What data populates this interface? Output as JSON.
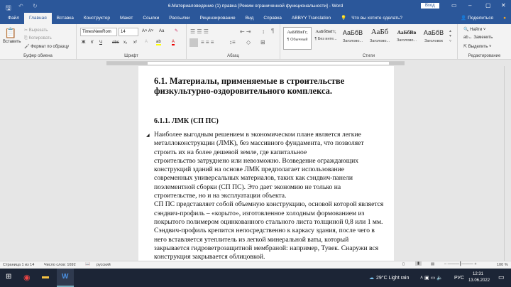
{
  "titlebar": {
    "title": "6.Материаловедение (1) правка [Режим ограниченной функциональности] - Word",
    "signin": "Вход"
  },
  "tabs": [
    "Файл",
    "Главная",
    "Вставка",
    "Конструктор",
    "Макет",
    "Ссылки",
    "Рассылки",
    "Рецензирование",
    "Вид",
    "Справка",
    "ABBYY Translation"
  ],
  "tell_me": "Что вы хотите сделать?",
  "share": "Поделиться",
  "clipboard": {
    "paste": "Вставить",
    "cut": "Вырезать",
    "copy": "Копировать",
    "format_painter": "Формат по образцу",
    "label": "Буфер обмена"
  },
  "font": {
    "name": "TimesNewRom",
    "size": "14",
    "label": "Шрифт",
    "bold": "Ж",
    "italic": "К",
    "underline": "Ч",
    "strike": "abc",
    "sub": "x₂",
    "sup": "x²",
    "case": "Aa"
  },
  "paragraph": {
    "label": "Абзац"
  },
  "styles": {
    "label": "Стили",
    "items": [
      {
        "preview": "АаБбВвГг,",
        "name": "¶ Обычный"
      },
      {
        "preview": "АаБбВвГг,",
        "name": "¶ Без инте..."
      },
      {
        "preview": "АаБбВ",
        "name": "Заголово..."
      },
      {
        "preview": "АаБб",
        "name": "Заголово..."
      },
      {
        "preview": "АаБбВв",
        "name": "Заголово..."
      },
      {
        "preview": "АаБбВ",
        "name": "Заголовок"
      }
    ]
  },
  "editing": {
    "find": "Найти",
    "replace": "Заменить",
    "select": "Выделить",
    "label": "Редактирование"
  },
  "document": {
    "heading": "6.1. Материалы, применяемые в строительстве физкультурно-оздоровительного комплекса.",
    "subheading": "6.1.1.  ЛМК (СП ПС)",
    "lines": [
      "Наиболее выгодным решением в экономическом плане является легкие",
      "металлоконструкции (ЛМК), без массивного фундамента, что позволяет",
      "строить их на более дешевой земле, где капитальное",
      "строительство затруднено или невозможно. Возведение ограждающих",
      "конструкций зданий на основе ЛМК предполагает использование",
      "современных универсальных материалов, таких как сэндвич-панели",
      "поэлементной сборки (СП ПС). Это дает экономию не только на",
      "строительстве, но и на эксплуатации объекта.",
      "СП ПС представляет собой объемную конструкцию, основой которой является",
      "сэндвич-профиль – «корыто», изготовленное холодным формованием из",
      "покрытого полимером оцинкованного стального листа толщиной 0,8 или 1 мм.",
      "Сэндвич-профиль крепится непосредственно к каркасу здания, после чего в",
      "него вставляется утеплитель из легкой минеральной ваты, который",
      "закрывается гидроветрозащитной мембраной: например, Тувек. Снаружи вся",
      "конструкция закрывается облицовкой."
    ]
  },
  "status": {
    "page": "Страница 1 из 14",
    "words": "Число слов: 1692",
    "language": "русский",
    "zoom": "100 %"
  },
  "taskbar": {
    "weather": "29°C  Light rain",
    "lang": "РУС",
    "time": "12:31",
    "date": "13.06.2022"
  }
}
